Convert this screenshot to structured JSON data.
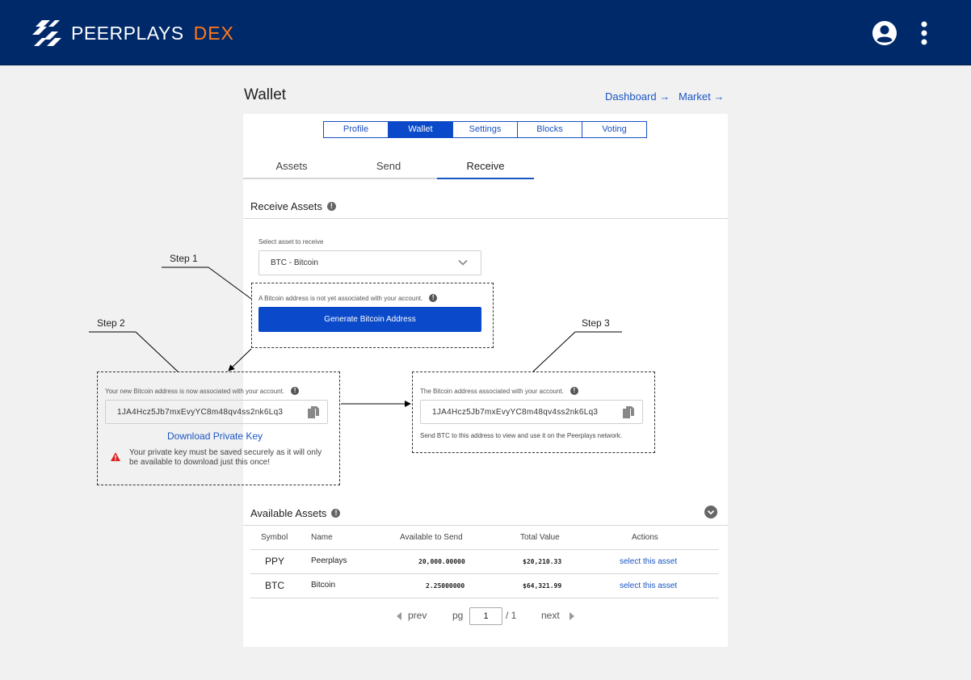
{
  "header": {
    "brand": "PEERPLAYS",
    "brand_suffix": "DEX"
  },
  "page": {
    "title": "Wallet",
    "dashboard_link": "Dashboard →",
    "market_link": "Market →"
  },
  "main_tabs": [
    "Profile",
    "Wallet",
    "Settings",
    "Blocks",
    "Voting"
  ],
  "sub_tabs": [
    "Assets",
    "Send",
    "Receive"
  ],
  "receive": {
    "heading": "Receive Assets",
    "select_label": "Select asset to receive",
    "selected_asset": "BTC - Bitcoin",
    "not_associated_note": "A Bitcoin address is not yet associated with your account.",
    "generate_button": "Generate Bitcoin Address",
    "new_address_note": "Your new Bitcoin address is now associated with your account.",
    "address": "1JA4Hcz5Jb7mxEvyYC8m48qv4ss2nk6Lq3",
    "download_link": "Download Private Key",
    "warning": "Your private key must be saved securely as it will only be available to download just this once!",
    "associated_note": "The Bitcoin address associated with your account.",
    "send_note": "Send BTC to this address to view and use it on the Peerplays network."
  },
  "steps": {
    "step1": "Step 1",
    "step2": "Step 2",
    "step3": "Step 3"
  },
  "available": {
    "heading": "Available Assets",
    "columns": [
      "Symbol",
      "Name",
      "Available to Send",
      "Total Value",
      "Actions"
    ],
    "rows": [
      {
        "symbol": "PPY",
        "name": "Peerplays",
        "available": "20,000.00000",
        "total": "$20,210.33",
        "action": "select this asset"
      },
      {
        "symbol": "BTC",
        "name": "Bitcoin",
        "available": "2.25000000",
        "total": "$64,321.99",
        "action": "select this asset"
      }
    ]
  },
  "pagination": {
    "prev": "prev",
    "pg": "pg",
    "page": "1",
    "total": "/ 1",
    "next": "next"
  },
  "colors": {
    "header_bg": "#00296a",
    "accent": "#0a49c9",
    "brand_suffix": "#ff7a1a",
    "link": "#1a56c4",
    "warning": "#e02020"
  },
  "icons": {
    "logo": "peerplays-logo-icon",
    "user": "user-account-icon",
    "menu": "more-vertical-icon",
    "info": "info-icon",
    "chevron": "chevron-down-icon",
    "copy": "copy-icon",
    "warning": "warning-icon"
  }
}
